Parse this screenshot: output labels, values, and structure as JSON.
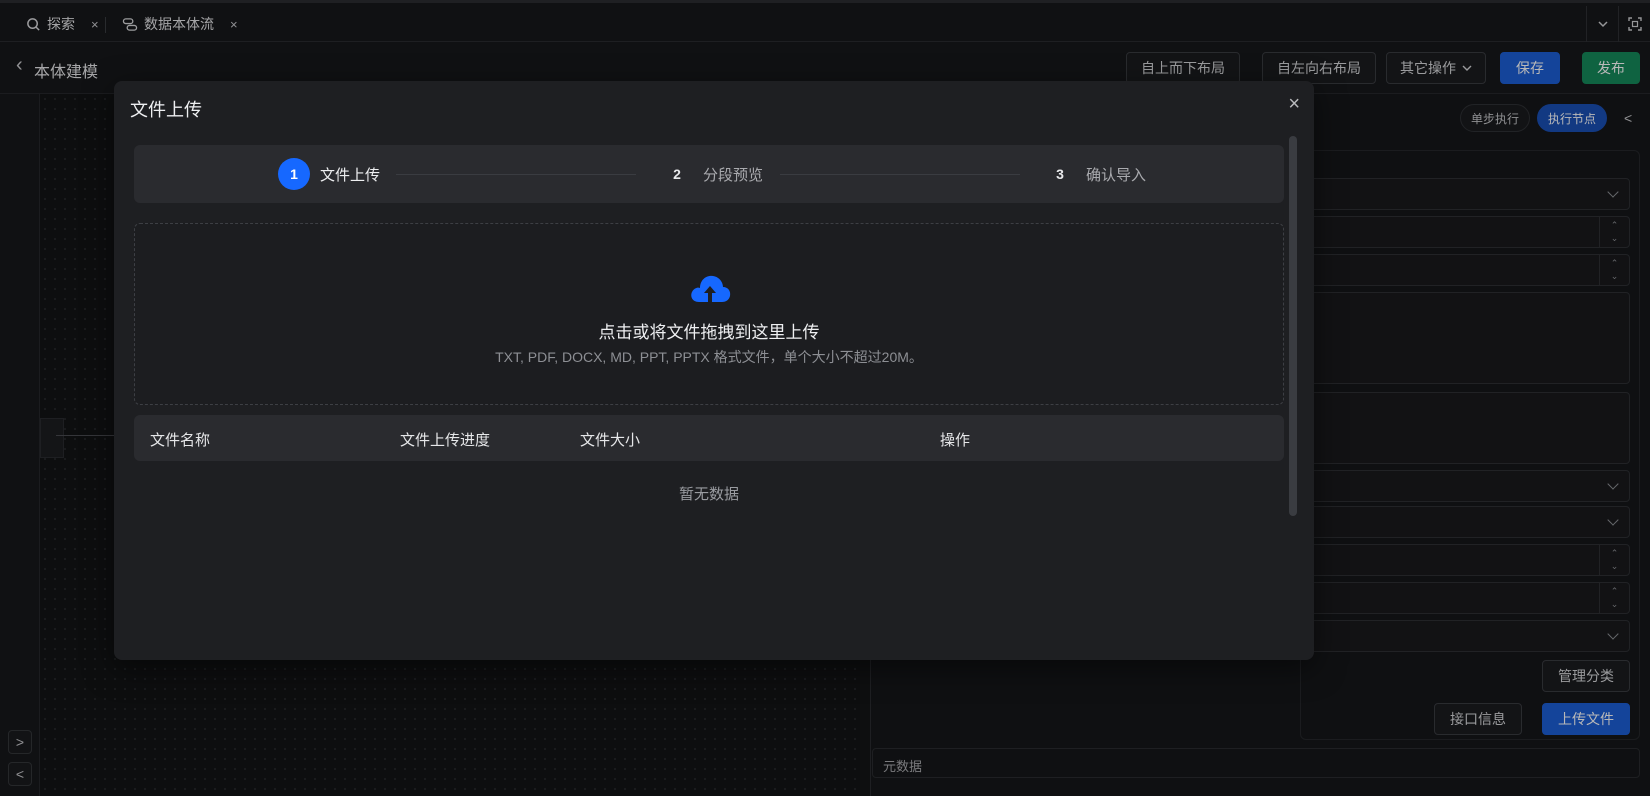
{
  "tabs": [
    {
      "label": "探索",
      "icon": "search-icon"
    },
    {
      "label": "数据本体流",
      "icon": "flow-icon"
    }
  ],
  "tab_close": "×",
  "header": {
    "back_icon": "‹",
    "title": "本体建模",
    "buttons": {
      "top_down": "自上而下布局",
      "left_right": "自左向右布局",
      "other": "其它操作",
      "save": "保存",
      "publish": "发布"
    }
  },
  "right_panel": {
    "single_step": "单步执行",
    "exec_node": "执行节点",
    "collapse": "<",
    "manage_category": "管理分类",
    "api_info": "接口信息",
    "upload_file": "上传文件",
    "metadata": "元数据"
  },
  "left_arrows": {
    "expand": ">",
    "collapse": "<"
  },
  "modal": {
    "title": "文件上传",
    "close": "×",
    "steps": [
      {
        "num": "1",
        "label": "文件上传"
      },
      {
        "num": "2",
        "label": "分段预览"
      },
      {
        "num": "3",
        "label": "确认导入"
      }
    ],
    "dropzone": {
      "main": "点击或将文件拖拽到这里上传",
      "sub": "TXT, PDF, DOCX, MD, PPT, PPTX 格式文件，单个大小不超过20M。"
    },
    "table": {
      "columns": [
        "文件名称",
        "文件上传进度",
        "文件大小",
        "操作"
      ],
      "empty": "暂无数据"
    }
  },
  "colors": {
    "accent": "#1668ff",
    "publish": "#16895a",
    "save": "#1d5fd6"
  }
}
